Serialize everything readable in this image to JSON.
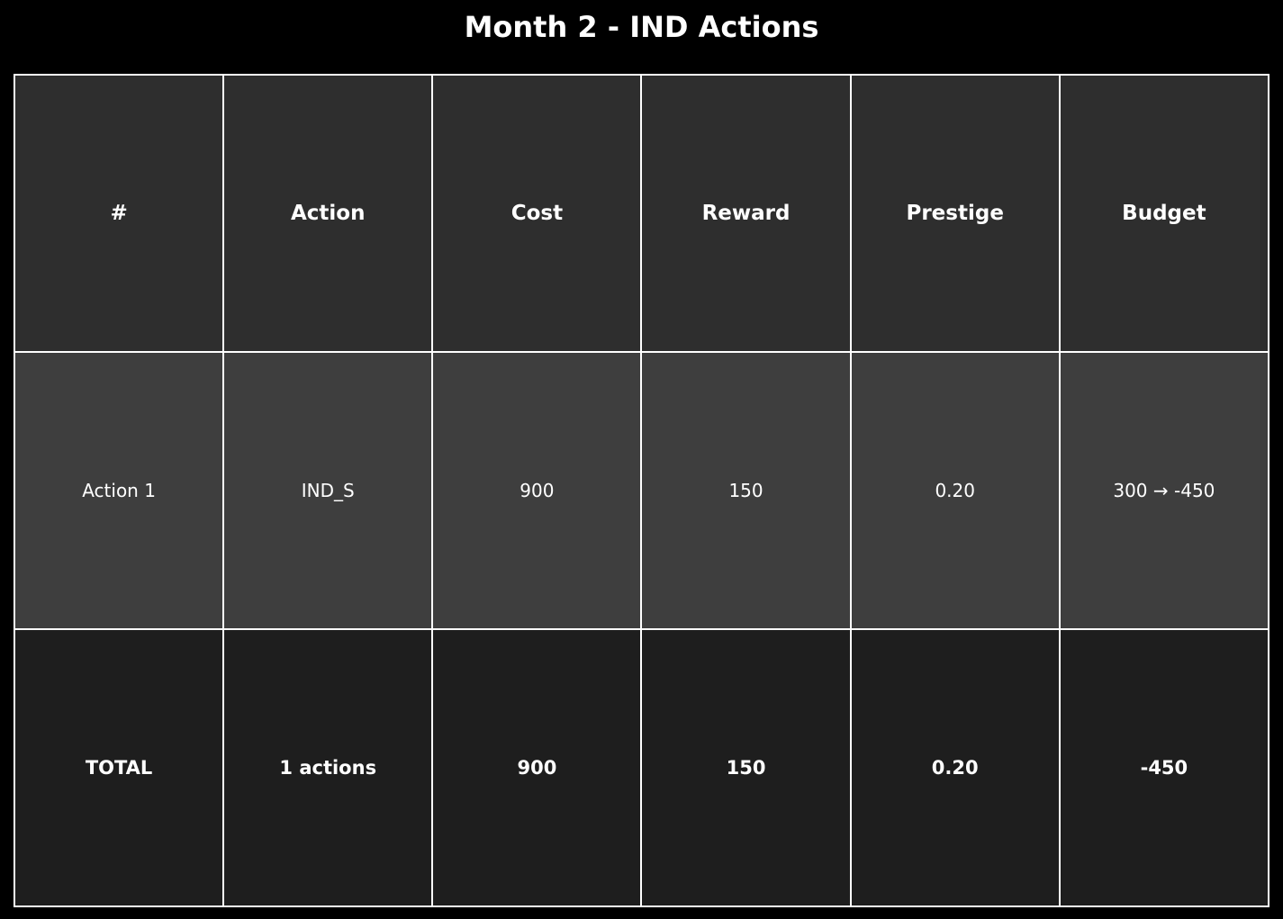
{
  "title": "Month 2 - IND Actions",
  "colors": {
    "background": "#000000",
    "header_fill": "#2e2e2e",
    "row_fill": "#3e3e3e",
    "total_fill": "#1e1e1e",
    "border": "#ffffff",
    "text": "#ffffff"
  },
  "chart_data": {
    "type": "table",
    "title": "Month 2 - IND Actions",
    "columns": [
      "#",
      "Action",
      "Cost",
      "Reward",
      "Prestige",
      "Budget"
    ],
    "rows": [
      [
        "Action 1",
        "IND_S",
        "900",
        "150",
        "0.20",
        "300 → -450"
      ]
    ],
    "total": [
      "TOTAL",
      "1 actions",
      "900",
      "150",
      "0.20",
      "-450"
    ]
  }
}
